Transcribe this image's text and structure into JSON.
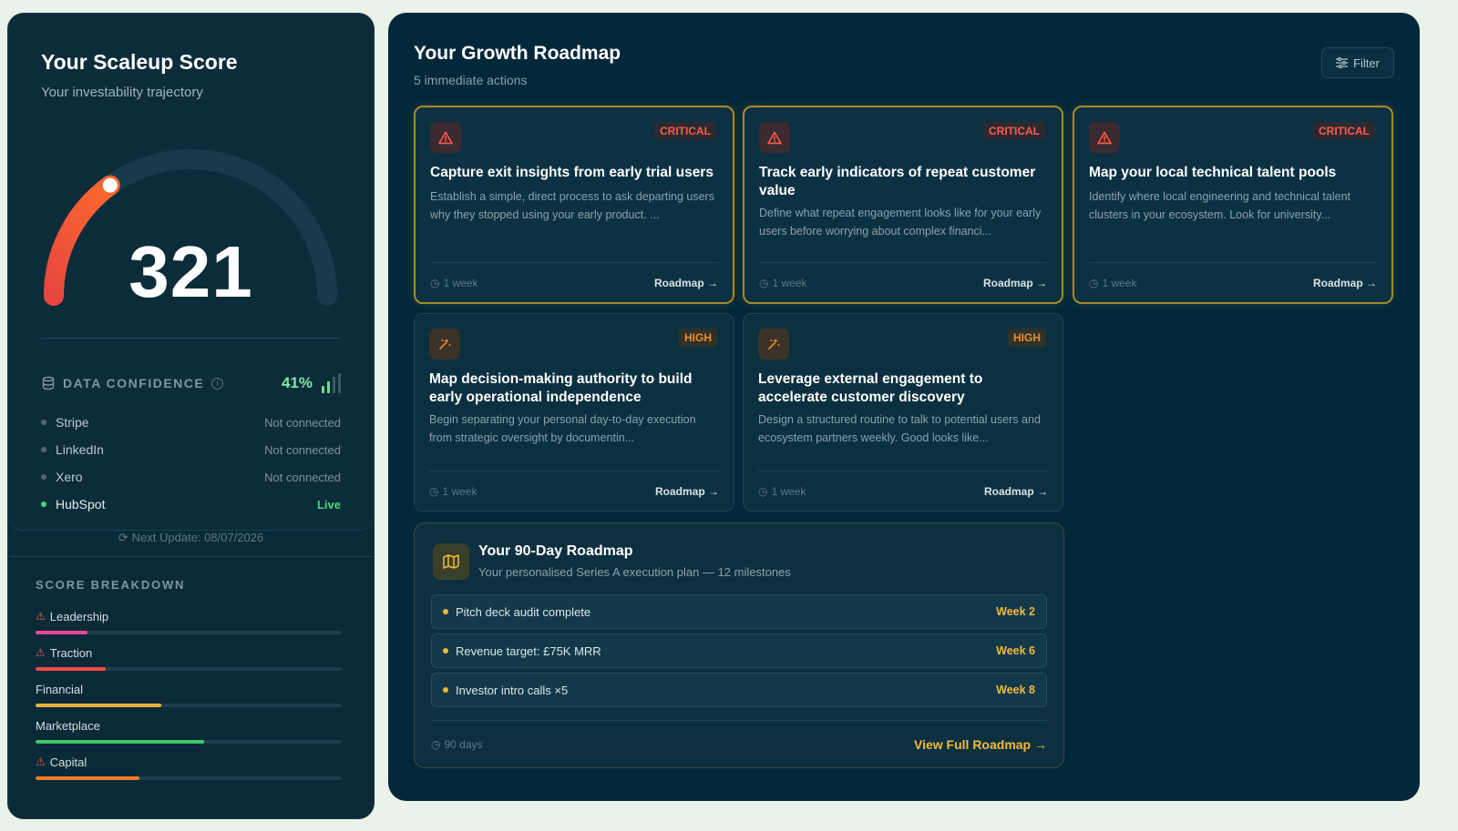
{
  "score": {
    "title": "Your Scaleup Score",
    "subtitle": "Your investability trajectory",
    "value": "321",
    "gauge_fraction": 0.3,
    "confidence_label": "DATA CONFIDENCE",
    "confidence_pct": "41%",
    "confidence_value": 0.41,
    "sources": [
      {
        "name": "Stripe",
        "status": "Not connected",
        "live": false
      },
      {
        "name": "LinkedIn",
        "status": "Not connected",
        "live": false
      },
      {
        "name": "Xero",
        "status": "Not connected",
        "live": false
      },
      {
        "name": "HubSpot",
        "status": "Live",
        "live": true
      }
    ],
    "next_update": "Next Update: 08/07/2026"
  },
  "breakdown": {
    "title": "SCORE BREAKDOWN",
    "items": [
      {
        "name": "Leadership",
        "warn": true,
        "value": 0.17,
        "color": "#e8489a"
      },
      {
        "name": "Traction",
        "warn": true,
        "value": 0.23,
        "color": "#ef4b4b"
      },
      {
        "name": "Financial",
        "warn": false,
        "value": 0.41,
        "color": "#e8b53c"
      },
      {
        "name": "Marketplace",
        "warn": false,
        "value": 0.55,
        "color": "#3fc56a"
      },
      {
        "name": "Capital",
        "warn": true,
        "value": 0.34,
        "color": "#f07a2a"
      }
    ]
  },
  "roadmap": {
    "title": "Your Growth Roadmap",
    "subtitle": "5 immediate actions",
    "filter_label": "Filter",
    "cards": [
      {
        "priority": "CRITICAL",
        "title": "Capture exit insights from early trial users",
        "desc": "Establish a simple, direct process to ask departing users why they stopped using your early product. ...",
        "duration": "1 week",
        "link": "Roadmap →"
      },
      {
        "priority": "CRITICAL",
        "title": "Track early indicators of repeat customer value",
        "desc": "Define what repeat engagement looks like for your early users before worrying about complex financi...",
        "duration": "1 week",
        "link": "Roadmap →"
      },
      {
        "priority": "CRITICAL",
        "title": "Map your local technical talent pools",
        "desc": "Identify where local engineering and technical talent clusters in your ecosystem. Look for university...",
        "duration": "1 week",
        "link": "Roadmap →"
      },
      {
        "priority": "HIGH",
        "title": "Map decision-making authority to build early operational independence",
        "desc": "Begin separating your personal day-to-day execution from strategic oversight by documentin...",
        "duration": "1 week",
        "link": "Roadmap →"
      },
      {
        "priority": "HIGH",
        "title": "Leverage external engagement to accelerate customer discovery",
        "desc": "Design a structured routine to talk to potential users and ecosystem partners weekly. Good looks like...",
        "duration": "1 week",
        "link": "Roadmap →"
      }
    ],
    "plan": {
      "title": "Your 90-Day Roadmap",
      "subtitle": "Your personalised Series A execution plan — 12 milestones",
      "milestones": [
        {
          "label": "Pitch deck audit complete",
          "week": "Week 2"
        },
        {
          "label": "Revenue target: £75K MRR",
          "week": "Week 6"
        },
        {
          "label": "Investor intro calls ×5",
          "week": "Week 8"
        }
      ],
      "duration": "90 days",
      "view_label": "View Full Roadmap →"
    }
  }
}
